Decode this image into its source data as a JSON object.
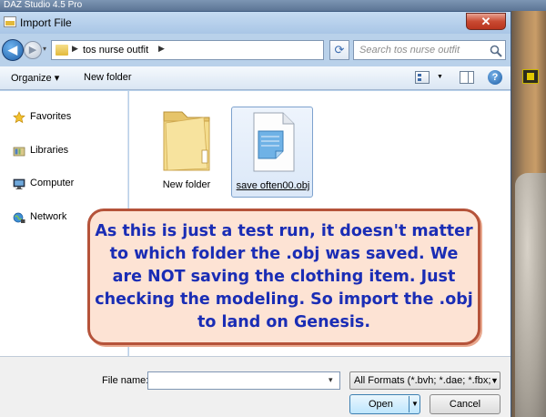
{
  "app": {
    "title": "DAZ Studio 4.5 Pro"
  },
  "dialog": {
    "title": "Import File",
    "close_label": "✕",
    "address": {
      "path": "tos nurse outfit"
    },
    "search": {
      "placeholder": "Search tos nurse outfit"
    },
    "toolbar": {
      "organize_label": "Organize ▾",
      "new_folder_label": "New folder"
    },
    "help_label": "?",
    "nav_items": [
      {
        "label": "Favorites",
        "icon": "star-icon"
      },
      {
        "label": "Libraries",
        "icon": "libraries-icon"
      },
      {
        "label": "Computer",
        "icon": "computer-icon"
      },
      {
        "label": "Network",
        "icon": "network-icon"
      }
    ],
    "files": [
      {
        "name": "New folder",
        "type": "folder",
        "selected": false
      },
      {
        "name": "save often00.obj",
        "type": "file",
        "selected": true
      }
    ],
    "file_name": {
      "label": "File name:",
      "value": ""
    },
    "filter": {
      "value": "All Formats (*.bvh; *.dae; *.fbx;"
    },
    "open_label": "Open",
    "cancel_label": "Cancel"
  },
  "callout": {
    "text": "As this is just a test run, it doesn't matter to which folder the .obj was saved. We are NOT saving the clothing item. Just checking the modeling. So import the .obj to land on Genesis."
  },
  "colors": {
    "callout_text": "#1a2db5",
    "callout_fill": "#fde3d4",
    "callout_border": "#b5533a",
    "close_button": "#c94a32"
  }
}
